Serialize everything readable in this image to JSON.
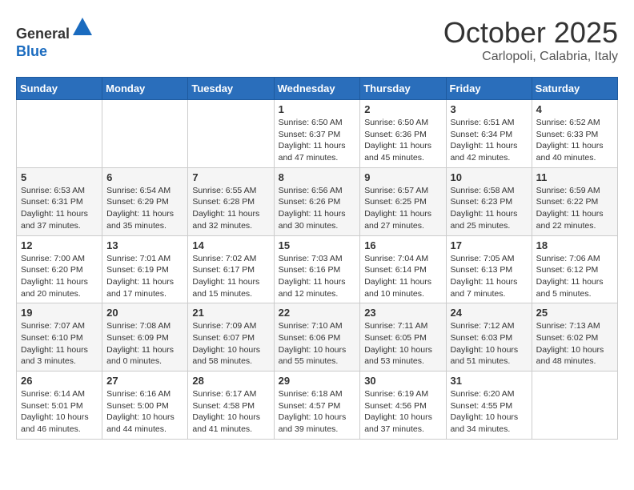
{
  "header": {
    "logo_line1": "General",
    "logo_line2": "Blue",
    "month": "October 2025",
    "location": "Carlopoli, Calabria, Italy"
  },
  "days_of_week": [
    "Sunday",
    "Monday",
    "Tuesday",
    "Wednesday",
    "Thursday",
    "Friday",
    "Saturday"
  ],
  "weeks": [
    [
      {
        "day": "",
        "info": ""
      },
      {
        "day": "",
        "info": ""
      },
      {
        "day": "",
        "info": ""
      },
      {
        "day": "1",
        "info": "Sunrise: 6:50 AM\nSunset: 6:37 PM\nDaylight: 11 hours and 47 minutes."
      },
      {
        "day": "2",
        "info": "Sunrise: 6:50 AM\nSunset: 6:36 PM\nDaylight: 11 hours and 45 minutes."
      },
      {
        "day": "3",
        "info": "Sunrise: 6:51 AM\nSunset: 6:34 PM\nDaylight: 11 hours and 42 minutes."
      },
      {
        "day": "4",
        "info": "Sunrise: 6:52 AM\nSunset: 6:33 PM\nDaylight: 11 hours and 40 minutes."
      }
    ],
    [
      {
        "day": "5",
        "info": "Sunrise: 6:53 AM\nSunset: 6:31 PM\nDaylight: 11 hours and 37 minutes."
      },
      {
        "day": "6",
        "info": "Sunrise: 6:54 AM\nSunset: 6:29 PM\nDaylight: 11 hours and 35 minutes."
      },
      {
        "day": "7",
        "info": "Sunrise: 6:55 AM\nSunset: 6:28 PM\nDaylight: 11 hours and 32 minutes."
      },
      {
        "day": "8",
        "info": "Sunrise: 6:56 AM\nSunset: 6:26 PM\nDaylight: 11 hours and 30 minutes."
      },
      {
        "day": "9",
        "info": "Sunrise: 6:57 AM\nSunset: 6:25 PM\nDaylight: 11 hours and 27 minutes."
      },
      {
        "day": "10",
        "info": "Sunrise: 6:58 AM\nSunset: 6:23 PM\nDaylight: 11 hours and 25 minutes."
      },
      {
        "day": "11",
        "info": "Sunrise: 6:59 AM\nSunset: 6:22 PM\nDaylight: 11 hours and 22 minutes."
      }
    ],
    [
      {
        "day": "12",
        "info": "Sunrise: 7:00 AM\nSunset: 6:20 PM\nDaylight: 11 hours and 20 minutes."
      },
      {
        "day": "13",
        "info": "Sunrise: 7:01 AM\nSunset: 6:19 PM\nDaylight: 11 hours and 17 minutes."
      },
      {
        "day": "14",
        "info": "Sunrise: 7:02 AM\nSunset: 6:17 PM\nDaylight: 11 hours and 15 minutes."
      },
      {
        "day": "15",
        "info": "Sunrise: 7:03 AM\nSunset: 6:16 PM\nDaylight: 11 hours and 12 minutes."
      },
      {
        "day": "16",
        "info": "Sunrise: 7:04 AM\nSunset: 6:14 PM\nDaylight: 11 hours and 10 minutes."
      },
      {
        "day": "17",
        "info": "Sunrise: 7:05 AM\nSunset: 6:13 PM\nDaylight: 11 hours and 7 minutes."
      },
      {
        "day": "18",
        "info": "Sunrise: 7:06 AM\nSunset: 6:12 PM\nDaylight: 11 hours and 5 minutes."
      }
    ],
    [
      {
        "day": "19",
        "info": "Sunrise: 7:07 AM\nSunset: 6:10 PM\nDaylight: 11 hours and 3 minutes."
      },
      {
        "day": "20",
        "info": "Sunrise: 7:08 AM\nSunset: 6:09 PM\nDaylight: 11 hours and 0 minutes."
      },
      {
        "day": "21",
        "info": "Sunrise: 7:09 AM\nSunset: 6:07 PM\nDaylight: 10 hours and 58 minutes."
      },
      {
        "day": "22",
        "info": "Sunrise: 7:10 AM\nSunset: 6:06 PM\nDaylight: 10 hours and 55 minutes."
      },
      {
        "day": "23",
        "info": "Sunrise: 7:11 AM\nSunset: 6:05 PM\nDaylight: 10 hours and 53 minutes."
      },
      {
        "day": "24",
        "info": "Sunrise: 7:12 AM\nSunset: 6:03 PM\nDaylight: 10 hours and 51 minutes."
      },
      {
        "day": "25",
        "info": "Sunrise: 7:13 AM\nSunset: 6:02 PM\nDaylight: 10 hours and 48 minutes."
      }
    ],
    [
      {
        "day": "26",
        "info": "Sunrise: 6:14 AM\nSunset: 5:01 PM\nDaylight: 10 hours and 46 minutes."
      },
      {
        "day": "27",
        "info": "Sunrise: 6:16 AM\nSunset: 5:00 PM\nDaylight: 10 hours and 44 minutes."
      },
      {
        "day": "28",
        "info": "Sunrise: 6:17 AM\nSunset: 4:58 PM\nDaylight: 10 hours and 41 minutes."
      },
      {
        "day": "29",
        "info": "Sunrise: 6:18 AM\nSunset: 4:57 PM\nDaylight: 10 hours and 39 minutes."
      },
      {
        "day": "30",
        "info": "Sunrise: 6:19 AM\nSunset: 4:56 PM\nDaylight: 10 hours and 37 minutes."
      },
      {
        "day": "31",
        "info": "Sunrise: 6:20 AM\nSunset: 4:55 PM\nDaylight: 10 hours and 34 minutes."
      },
      {
        "day": "",
        "info": ""
      }
    ]
  ]
}
